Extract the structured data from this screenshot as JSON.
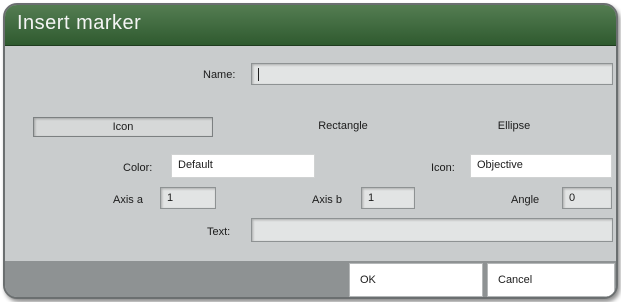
{
  "title": "Insert marker",
  "name": {
    "label": "Name:",
    "value": ""
  },
  "shape_tabs": [
    {
      "label": "Icon",
      "selected": true
    },
    {
      "label": "Rectangle",
      "selected": false
    },
    {
      "label": "Ellipse",
      "selected": false
    }
  ],
  "color": {
    "label": "Color:",
    "value": "Default"
  },
  "icon": {
    "label": "Icon:",
    "value": "Objective"
  },
  "axis_a": {
    "label": "Axis a",
    "value": "1"
  },
  "axis_b": {
    "label": "Axis b",
    "value": "1"
  },
  "angle": {
    "label": "Angle",
    "value": "0"
  },
  "text": {
    "label": "Text:",
    "value": ""
  },
  "buttons": {
    "ok": "OK",
    "cancel": "Cancel"
  }
}
